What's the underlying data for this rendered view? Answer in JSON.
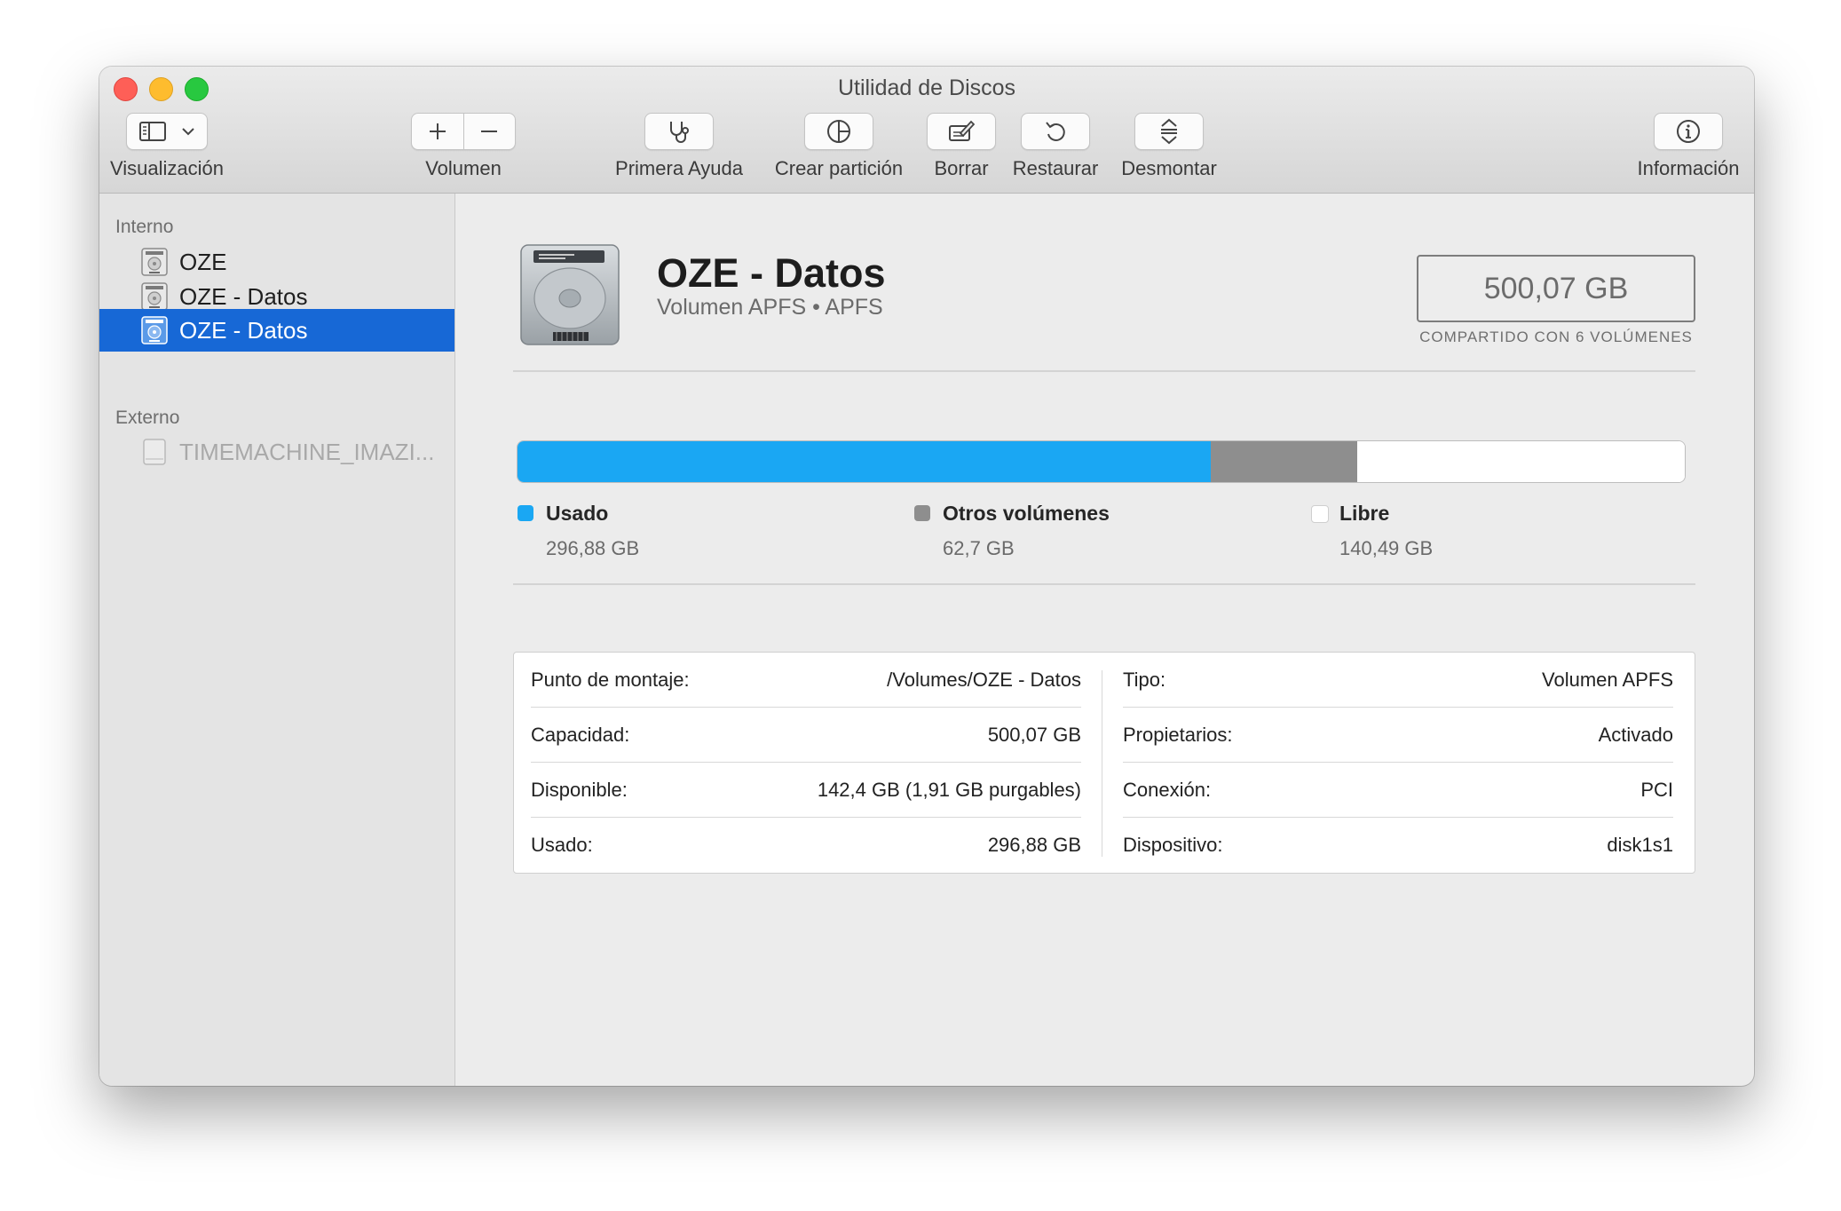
{
  "window": {
    "title": "Utilidad de Discos"
  },
  "toolbar": {
    "view_label": "Visualización",
    "volume_label": "Volumen",
    "first_aid_label": "Primera Ayuda",
    "partition_label": "Crear partición",
    "erase_label": "Borrar",
    "restore_label": "Restaurar",
    "unmount_label": "Desmontar",
    "info_label": "Información"
  },
  "sidebar": {
    "internal_header": "Interno",
    "external_header": "Externo",
    "internal_items": [
      {
        "label": "OZE",
        "icon": "internal-disk-icon"
      },
      {
        "label": "OZE - Datos",
        "icon": "internal-disk-icon"
      },
      {
        "label": "OZE - Datos",
        "icon": "internal-disk-icon",
        "selected": true
      }
    ],
    "external_items": [
      {
        "label": "TIMEMACHINE_IMAZI...",
        "icon": "external-disk-icon",
        "disabled": true
      }
    ]
  },
  "volume": {
    "name": "OZE - Datos",
    "subtitle": "Volumen APFS • APFS",
    "capacity": "500,07 GB",
    "capacity_note": "COMPARTIDO CON 6 VOLÚMENES"
  },
  "usage": {
    "segments": [
      {
        "name": "Usado",
        "value": "296,88 GB",
        "gb": 296.88,
        "color": "#1aa7f3"
      },
      {
        "name": "Otros volúmenes",
        "value": "62,7 GB",
        "gb": 62.7,
        "color": "#8e8e8e"
      },
      {
        "name": "Libre",
        "value": "140,49 GB",
        "gb": 140.49,
        "color": "#ffffff"
      }
    ],
    "total_gb": 500.07
  },
  "details": {
    "left": [
      {
        "label": "Punto de montaje:",
        "value": "/Volumes/OZE - Datos"
      },
      {
        "label": "Capacidad:",
        "value": "500,07 GB"
      },
      {
        "label": "Disponible:",
        "value": "142,4 GB (1,91 GB purgables)"
      },
      {
        "label": "Usado:",
        "value": "296,88 GB"
      }
    ],
    "right": [
      {
        "label": "Tipo:",
        "value": "Volumen APFS"
      },
      {
        "label": "Propietarios:",
        "value": "Activado"
      },
      {
        "label": "Conexión:",
        "value": "PCI"
      },
      {
        "label": "Dispositivo:",
        "value": "disk1s1"
      }
    ]
  }
}
